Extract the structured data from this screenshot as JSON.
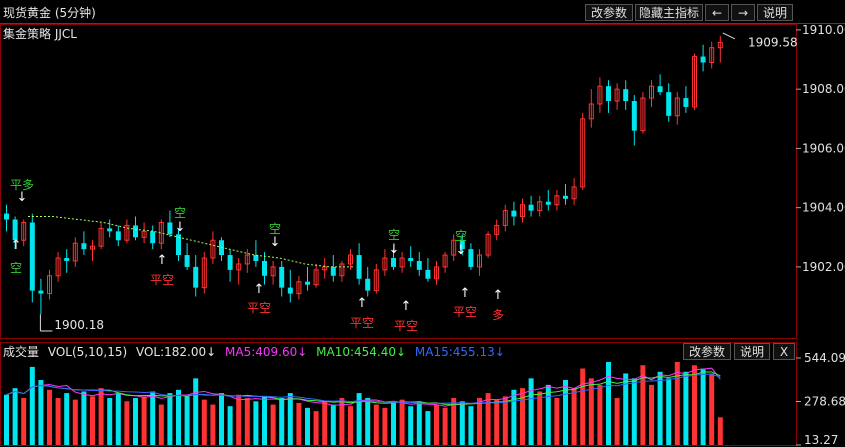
{
  "header": {
    "title": "现货黄金 (5分钟)",
    "strategy": "集金策略 JJCL",
    "buttons": [
      "改参数",
      "隐藏主指标",
      "←",
      "→",
      "说明"
    ]
  },
  "price_axis": {
    "ticks": [
      "1910.00",
      "1908.00",
      "1906.00",
      "1904.00",
      "1902.00"
    ],
    "last_price": "1909.58",
    "low_label": "1900.18"
  },
  "signals": [
    {
      "text": "平多",
      "arrow": "↓",
      "color": "#33cc33"
    },
    {
      "text": "空",
      "arrow": "↑",
      "color": "#33cc33"
    },
    {
      "text": "空",
      "arrow": "↓",
      "color": "#33cc33"
    },
    {
      "text": "平空",
      "arrow": "↑",
      "color": "#ff3333"
    },
    {
      "text": "平空",
      "arrow": "↑",
      "color": "#ff3333"
    },
    {
      "text": "空",
      "arrow": "↓",
      "color": "#33cc33"
    },
    {
      "text": "平空",
      "arrow": "↑",
      "color": "#ff3333"
    },
    {
      "text": "空",
      "arrow": "↓",
      "color": "#33cc33"
    },
    {
      "text": "平空",
      "arrow": "↑",
      "color": "#ff3333"
    },
    {
      "text": "空",
      "arrow": "↓",
      "color": "#33cc33"
    },
    {
      "text": "平空",
      "arrow": "↑",
      "color": "#ff3333"
    },
    {
      "text": "多",
      "arrow": "↑",
      "color": "#ff3333"
    }
  ],
  "volume": {
    "title": "成交量",
    "vol_params": "VOL(5,10,15)",
    "vol": "VOL:182.00↓",
    "ma5": "MA5:409.60↓",
    "ma10": "MA10:454.40↓",
    "ma15": "MA15:455.13↓",
    "buttons": [
      "改参数",
      "说明",
      "X"
    ],
    "ticks": [
      "544.09",
      "278.68",
      "13.27"
    ]
  },
  "colors": {
    "up": "#ff3333",
    "down": "#00e5ee",
    "grid": "#8b0000",
    "dash": "#aaff55",
    "ma5": "#ff33ff",
    "ma10": "#44ee44",
    "ma15": "#3366ff"
  },
  "chart_data": {
    "type": "candlestick",
    "ylim": [
      1899.6,
      1910.2
    ],
    "candles": [
      [
        1903.8,
        1904.1,
        1903.2,
        1903.6
      ],
      [
        1903.6,
        1903.7,
        1902.6,
        1902.9
      ],
      [
        1902.9,
        1903.6,
        1902.7,
        1903.5
      ],
      [
        1903.5,
        1903.8,
        1900.8,
        1901.2
      ],
      [
        1901.2,
        1901.6,
        1900.4,
        1901.1
      ],
      [
        1901.1,
        1901.9,
        1900.9,
        1901.7
      ],
      [
        1901.7,
        1902.5,
        1901.5,
        1902.3
      ],
      [
        1902.3,
        1902.6,
        1901.8,
        1902.2
      ],
      [
        1902.2,
        1903.0,
        1902.0,
        1902.8
      ],
      [
        1902.8,
        1903.2,
        1902.4,
        1902.6
      ],
      [
        1902.6,
        1902.9,
        1902.2,
        1902.7
      ],
      [
        1902.7,
        1903.5,
        1902.6,
        1903.3
      ],
      [
        1903.3,
        1903.6,
        1903.0,
        1903.2
      ],
      [
        1903.2,
        1903.4,
        1902.7,
        1902.9
      ],
      [
        1902.9,
        1903.6,
        1902.8,
        1903.4
      ],
      [
        1903.4,
        1903.7,
        1902.9,
        1903.0
      ],
      [
        1903.0,
        1903.5,
        1902.8,
        1903.2
      ],
      [
        1903.2,
        1903.4,
        1902.6,
        1902.8
      ],
      [
        1902.8,
        1903.6,
        1902.6,
        1903.5
      ],
      [
        1903.5,
        1903.9,
        1903.0,
        1903.1
      ],
      [
        1903.1,
        1903.3,
        1902.2,
        1902.4
      ],
      [
        1902.4,
        1902.8,
        1901.9,
        1902.0
      ],
      [
        1902.0,
        1902.4,
        1901.0,
        1901.3
      ],
      [
        1901.3,
        1902.5,
        1901.1,
        1902.3
      ],
      [
        1902.3,
        1903.2,
        1902.1,
        1902.9
      ],
      [
        1902.9,
        1903.0,
        1902.2,
        1902.4
      ],
      [
        1902.4,
        1902.6,
        1901.5,
        1901.9
      ],
      [
        1901.9,
        1902.3,
        1901.4,
        1902.1
      ],
      [
        1902.1,
        1902.6,
        1901.8,
        1902.4
      ],
      [
        1902.4,
        1902.9,
        1902.0,
        1902.2
      ],
      [
        1902.2,
        1902.5,
        1901.4,
        1901.7
      ],
      [
        1901.7,
        1902.2,
        1901.4,
        1902.0
      ],
      [
        1902.0,
        1902.2,
        1901.0,
        1901.3
      ],
      [
        1901.3,
        1901.9,
        1900.8,
        1901.1
      ],
      [
        1901.1,
        1901.7,
        1900.9,
        1901.5
      ],
      [
        1901.5,
        1902.0,
        1901.2,
        1901.4
      ],
      [
        1901.4,
        1902.1,
        1901.3,
        1901.9
      ],
      [
        1901.9,
        1902.3,
        1901.6,
        1902.0
      ],
      [
        1902.0,
        1902.4,
        1901.5,
        1901.7
      ],
      [
        1901.7,
        1902.2,
        1901.5,
        1902.1
      ],
      [
        1902.1,
        1902.6,
        1901.9,
        1902.4
      ],
      [
        1902.4,
        1902.8,
        1901.4,
        1901.6
      ],
      [
        1901.6,
        1902.0,
        1901.0,
        1901.2
      ],
      [
        1901.2,
        1902.1,
        1901.1,
        1901.9
      ],
      [
        1901.9,
        1902.6,
        1901.7,
        1902.3
      ],
      [
        1902.3,
        1902.6,
        1901.9,
        1902.0
      ],
      [
        1902.0,
        1902.5,
        1901.8,
        1902.3
      ],
      [
        1902.3,
        1902.7,
        1902.0,
        1902.2
      ],
      [
        1902.2,
        1902.5,
        1901.7,
        1901.9
      ],
      [
        1901.9,
        1902.3,
        1901.5,
        1901.6
      ],
      [
        1901.6,
        1902.2,
        1901.4,
        1902.0
      ],
      [
        1902.0,
        1902.5,
        1901.8,
        1902.4
      ],
      [
        1902.4,
        1903.1,
        1902.2,
        1902.9
      ],
      [
        1902.9,
        1903.1,
        1902.4,
        1902.6
      ],
      [
        1902.6,
        1902.8,
        1901.9,
        1902.0
      ],
      [
        1902.0,
        1902.6,
        1901.7,
        1902.4
      ],
      [
        1902.4,
        1903.2,
        1902.3,
        1903.1
      ],
      [
        1903.1,
        1903.6,
        1902.9,
        1903.4
      ],
      [
        1903.4,
        1904.1,
        1903.2,
        1903.9
      ],
      [
        1903.9,
        1904.2,
        1903.4,
        1903.7
      ],
      [
        1903.7,
        1904.3,
        1903.5,
        1904.1
      ],
      [
        1904.1,
        1904.4,
        1903.7,
        1903.9
      ],
      [
        1903.9,
        1904.4,
        1903.7,
        1904.2
      ],
      [
        1904.2,
        1904.6,
        1903.9,
        1904.1
      ],
      [
        1904.1,
        1904.6,
        1903.9,
        1904.4
      ],
      [
        1904.4,
        1904.8,
        1904.1,
        1904.3
      ],
      [
        1904.3,
        1905.0,
        1904.1,
        1904.7
      ],
      [
        1904.7,
        1907.2,
        1904.6,
        1907.0
      ],
      [
        1907.0,
        1908.0,
        1906.7,
        1907.5
      ],
      [
        1907.5,
        1908.4,
        1907.2,
        1908.1
      ],
      [
        1908.1,
        1908.3,
        1907.2,
        1907.6
      ],
      [
        1907.6,
        1908.2,
        1907.3,
        1908.0
      ],
      [
        1908.0,
        1908.3,
        1907.3,
        1907.6
      ],
      [
        1907.6,
        1907.8,
        1906.1,
        1906.6
      ],
      [
        1906.6,
        1907.9,
        1906.5,
        1907.7
      ],
      [
        1907.7,
        1908.3,
        1907.4,
        1908.1
      ],
      [
        1908.1,
        1908.5,
        1907.8,
        1907.9
      ],
      [
        1907.9,
        1908.2,
        1906.9,
        1907.1
      ],
      [
        1907.1,
        1907.9,
        1906.8,
        1907.7
      ],
      [
        1907.7,
        1908.1,
        1907.2,
        1907.4
      ],
      [
        1907.4,
        1909.2,
        1907.3,
        1909.1
      ],
      [
        1909.1,
        1909.5,
        1908.6,
        1908.9
      ],
      [
        1908.9,
        1909.6,
        1908.7,
        1909.4
      ],
      [
        1909.4,
        1909.8,
        1908.9,
        1909.58
      ]
    ],
    "dashed_line": [
      1903.7,
      1903.7,
      1903.6,
      1903.5,
      1903.3,
      1903.2,
      1903.0,
      1902.8,
      1902.6,
      1902.4,
      1902.3,
      1902.1,
      1902.0,
      1902.0
    ],
    "volume_series": [
      {
        "name": "VOL",
        "values": [
          320,
          360,
          300,
          490,
          410,
          350,
          300,
          330,
          290,
          340,
          310,
          360,
          300,
          330,
          280,
          300,
          310,
          340,
          260,
          330,
          350,
          310,
          420,
          290,
          260,
          330,
          250,
          320,
          300,
          280,
          310,
          260,
          300,
          330,
          270,
          240,
          220,
          280,
          260,
          300,
          250,
          330,
          300,
          260,
          240,
          270,
          290,
          250,
          280,
          220,
          260,
          240,
          300,
          280,
          250,
          300,
          330,
          290,
          310,
          350,
          360,
          420,
          340,
          380,
          300,
          410,
          360,
          480,
          420,
          380,
          520,
          300,
          450,
          420,
          500,
          380,
          460,
          420,
          520,
          460,
          500,
          480,
          450,
          182
        ]
      }
    ]
  }
}
